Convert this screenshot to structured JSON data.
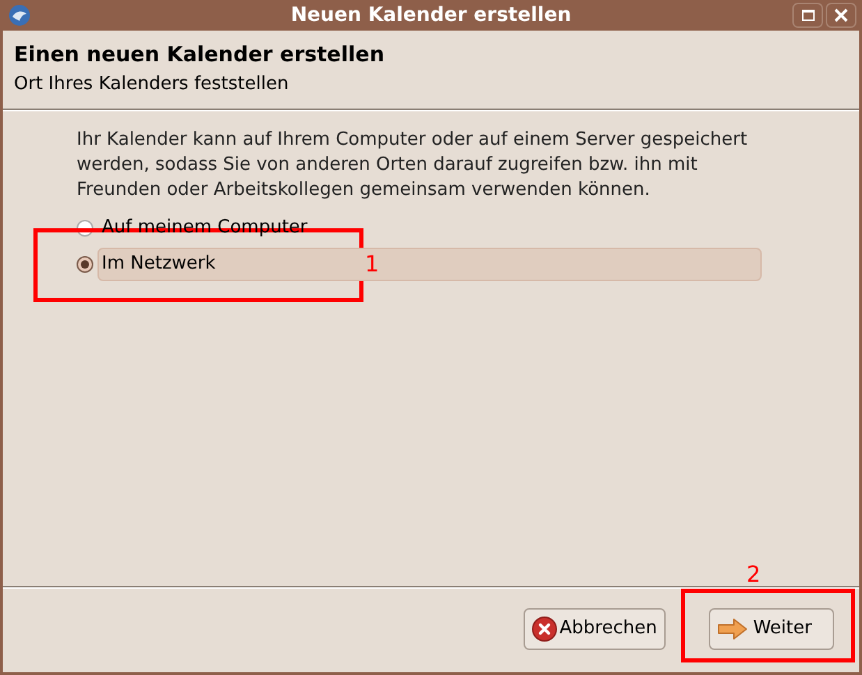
{
  "window": {
    "title": "Neuen Kalender erstellen"
  },
  "header": {
    "title": "Einen neuen Kalender erstellen",
    "subtitle": "Ort Ihres Kalenders feststellen"
  },
  "description": "Ihr Kalender kann auf Ihrem Computer oder auf einem Server gespeichert werden, sodass Sie von anderen Orten darauf zugreifen bzw. ihn mit Freunden oder Arbeitskollegen gemeinsam verwenden können.",
  "options": [
    {
      "label": "Auf meinem Computer",
      "selected": false
    },
    {
      "label": "Im Netzwerk",
      "selected": true
    }
  ],
  "buttons": [
    {
      "kind": "cancel",
      "label": "Abbrechen"
    },
    {
      "kind": "next",
      "label": "Weiter"
    }
  ],
  "annotations": [
    {
      "label": "1"
    },
    {
      "label": "2"
    }
  ]
}
